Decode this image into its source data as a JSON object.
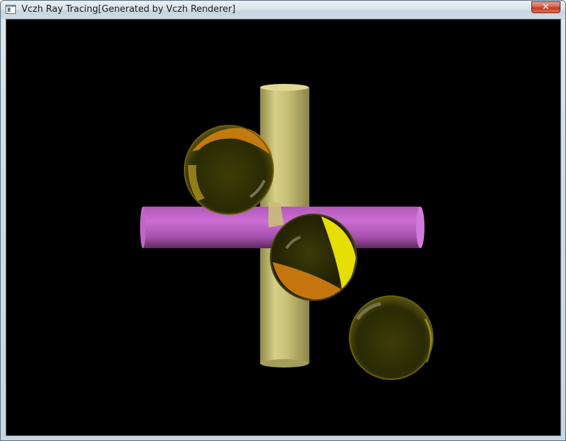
{
  "window": {
    "title": "Vczh Ray Tracing[Generated by Vczh Renderer]",
    "close_glyph": "✕"
  },
  "icons": {
    "app": "app-window-icon",
    "close": "close-icon"
  },
  "colors": {
    "viewport_background": "#000000",
    "cylinder_vertical": "#cfc77a",
    "cylinder_horizontal": "#c068c8",
    "sphere_glass": "#3a3a06",
    "highlight_orange": "#e08a10",
    "highlight_yellow": "#e8e000"
  }
}
